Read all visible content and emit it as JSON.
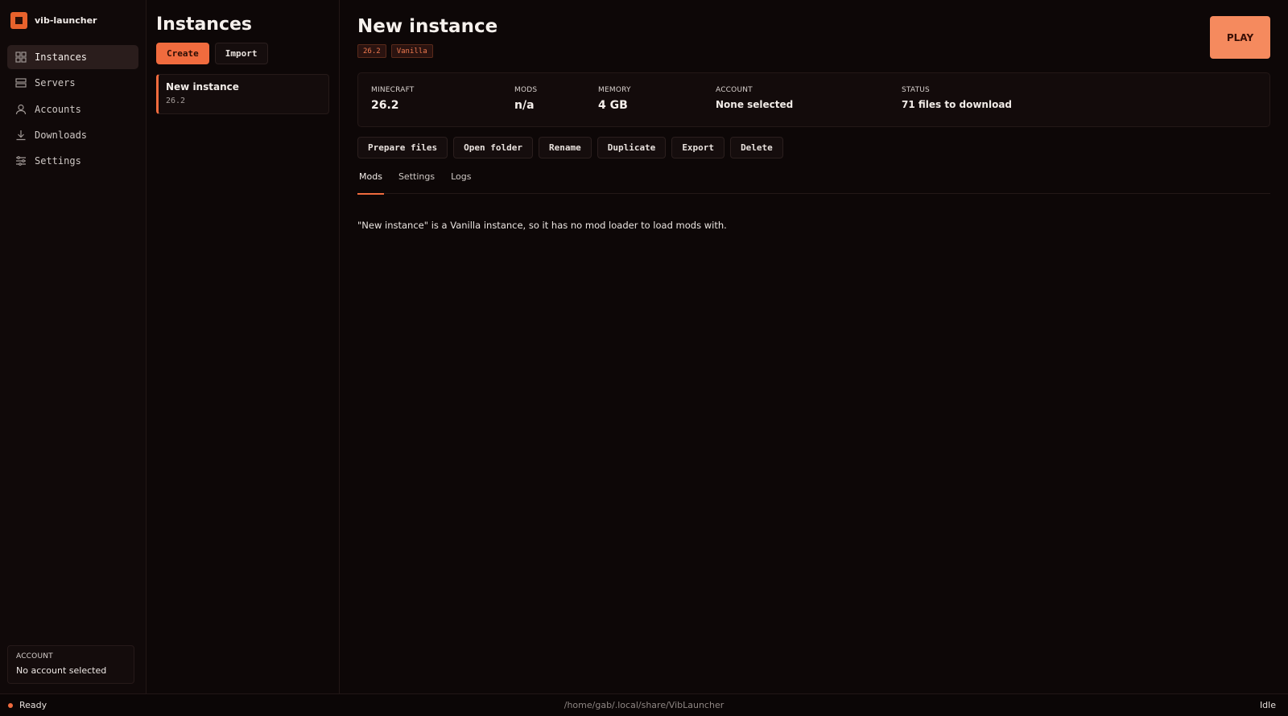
{
  "app": {
    "name": "vib-launcher"
  },
  "sidebar": {
    "items": [
      {
        "label": "Instances",
        "icon": "grid-icon"
      },
      {
        "label": "Servers",
        "icon": "server-icon"
      },
      {
        "label": "Accounts",
        "icon": "user-icon"
      },
      {
        "label": "Downloads",
        "icon": "download-icon"
      },
      {
        "label": "Settings",
        "icon": "sliders-icon"
      }
    ],
    "account": {
      "label": "ACCOUNT",
      "value": "No account selected"
    }
  },
  "instances": {
    "title": "Instances",
    "create_label": "Create",
    "import_label": "Import",
    "list": [
      {
        "name": "New instance",
        "version": "26.2"
      }
    ]
  },
  "detail": {
    "title": "New instance",
    "tags": [
      "26.2",
      "Vanilla"
    ],
    "play_label": "PLAY",
    "stats": {
      "minecraft": {
        "label": "MINECRAFT",
        "value": "26.2"
      },
      "mods": {
        "label": "MODS",
        "value": "n/a"
      },
      "memory": {
        "label": "MEMORY",
        "value": "4 GB"
      },
      "account": {
        "label": "ACCOUNT",
        "value": "None selected"
      },
      "status": {
        "label": "STATUS",
        "value": "71 files to download"
      }
    },
    "actions": [
      "Prepare files",
      "Open folder",
      "Rename",
      "Duplicate",
      "Export",
      "Delete"
    ],
    "tabs": [
      "Mods",
      "Settings",
      "Logs"
    ],
    "active_tab": "Mods",
    "message": "\"New instance\" is a Vanilla instance, so it has no mod loader to load mods with."
  },
  "statusbar": {
    "left": "Ready",
    "path": "/home/gab/.local/share/VibLauncher",
    "right": "Idle"
  },
  "colors": {
    "accent": "#f06b3e",
    "play": "#f58a5e",
    "background": "#0d0707"
  }
}
